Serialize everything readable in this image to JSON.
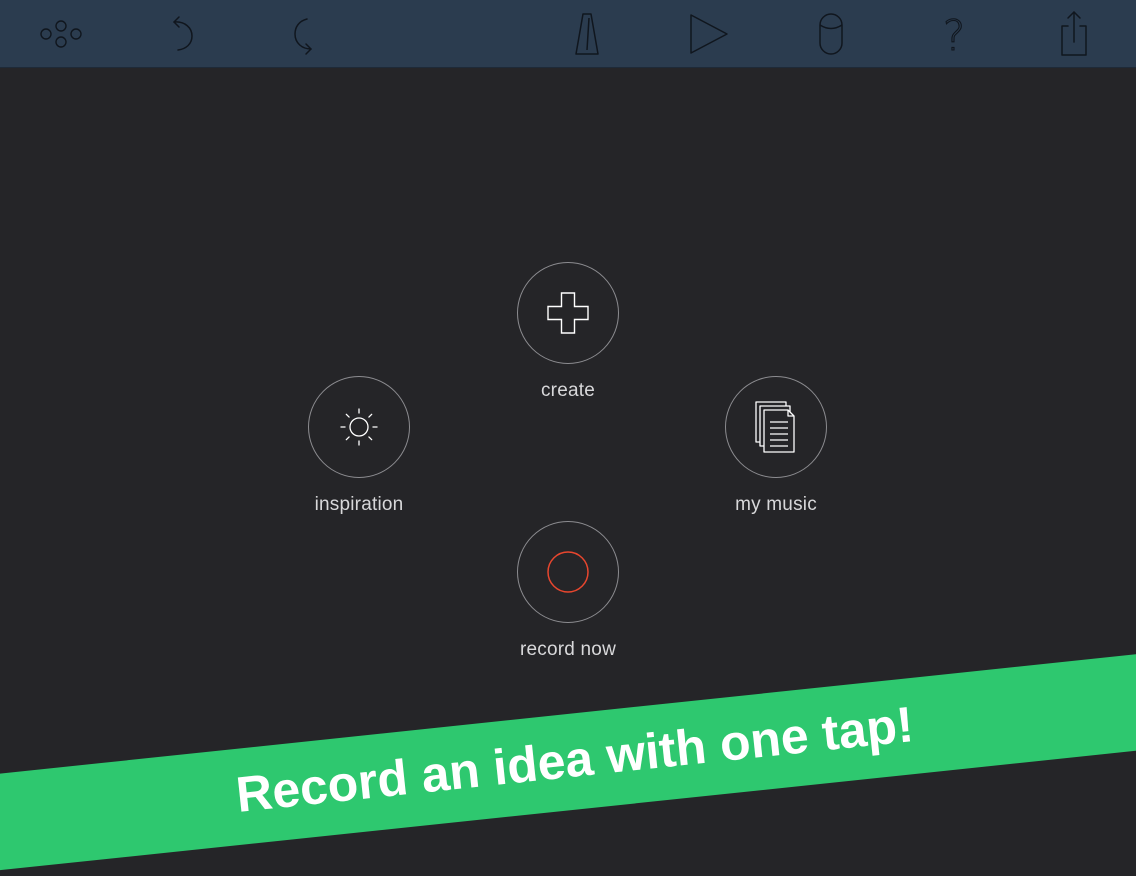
{
  "toolbar": {
    "icons": [
      {
        "name": "tracks-icon"
      },
      {
        "name": "undo-icon"
      },
      {
        "name": "redo-icon"
      },
      {
        "name": "metronome-icon"
      },
      {
        "name": "play-icon"
      },
      {
        "name": "storage-icon"
      },
      {
        "name": "help-icon"
      },
      {
        "name": "share-icon"
      }
    ],
    "help_glyph": "?"
  },
  "actions": {
    "create": {
      "label": "create",
      "icon": "plus-icon"
    },
    "inspiration": {
      "label": "inspiration",
      "icon": "sun-icon"
    },
    "my_music": {
      "label": "my music",
      "icon": "documents-icon"
    },
    "record_now": {
      "label": "record now",
      "icon": "record-icon"
    }
  },
  "banner": {
    "text": "Record an idea with one tap!"
  },
  "colors": {
    "toolbar_bg": "#2b3c4f",
    "background": "#252528",
    "banner": "#2ec86f",
    "record_accent": "#e8462e",
    "icon_stroke": "#10161e"
  }
}
